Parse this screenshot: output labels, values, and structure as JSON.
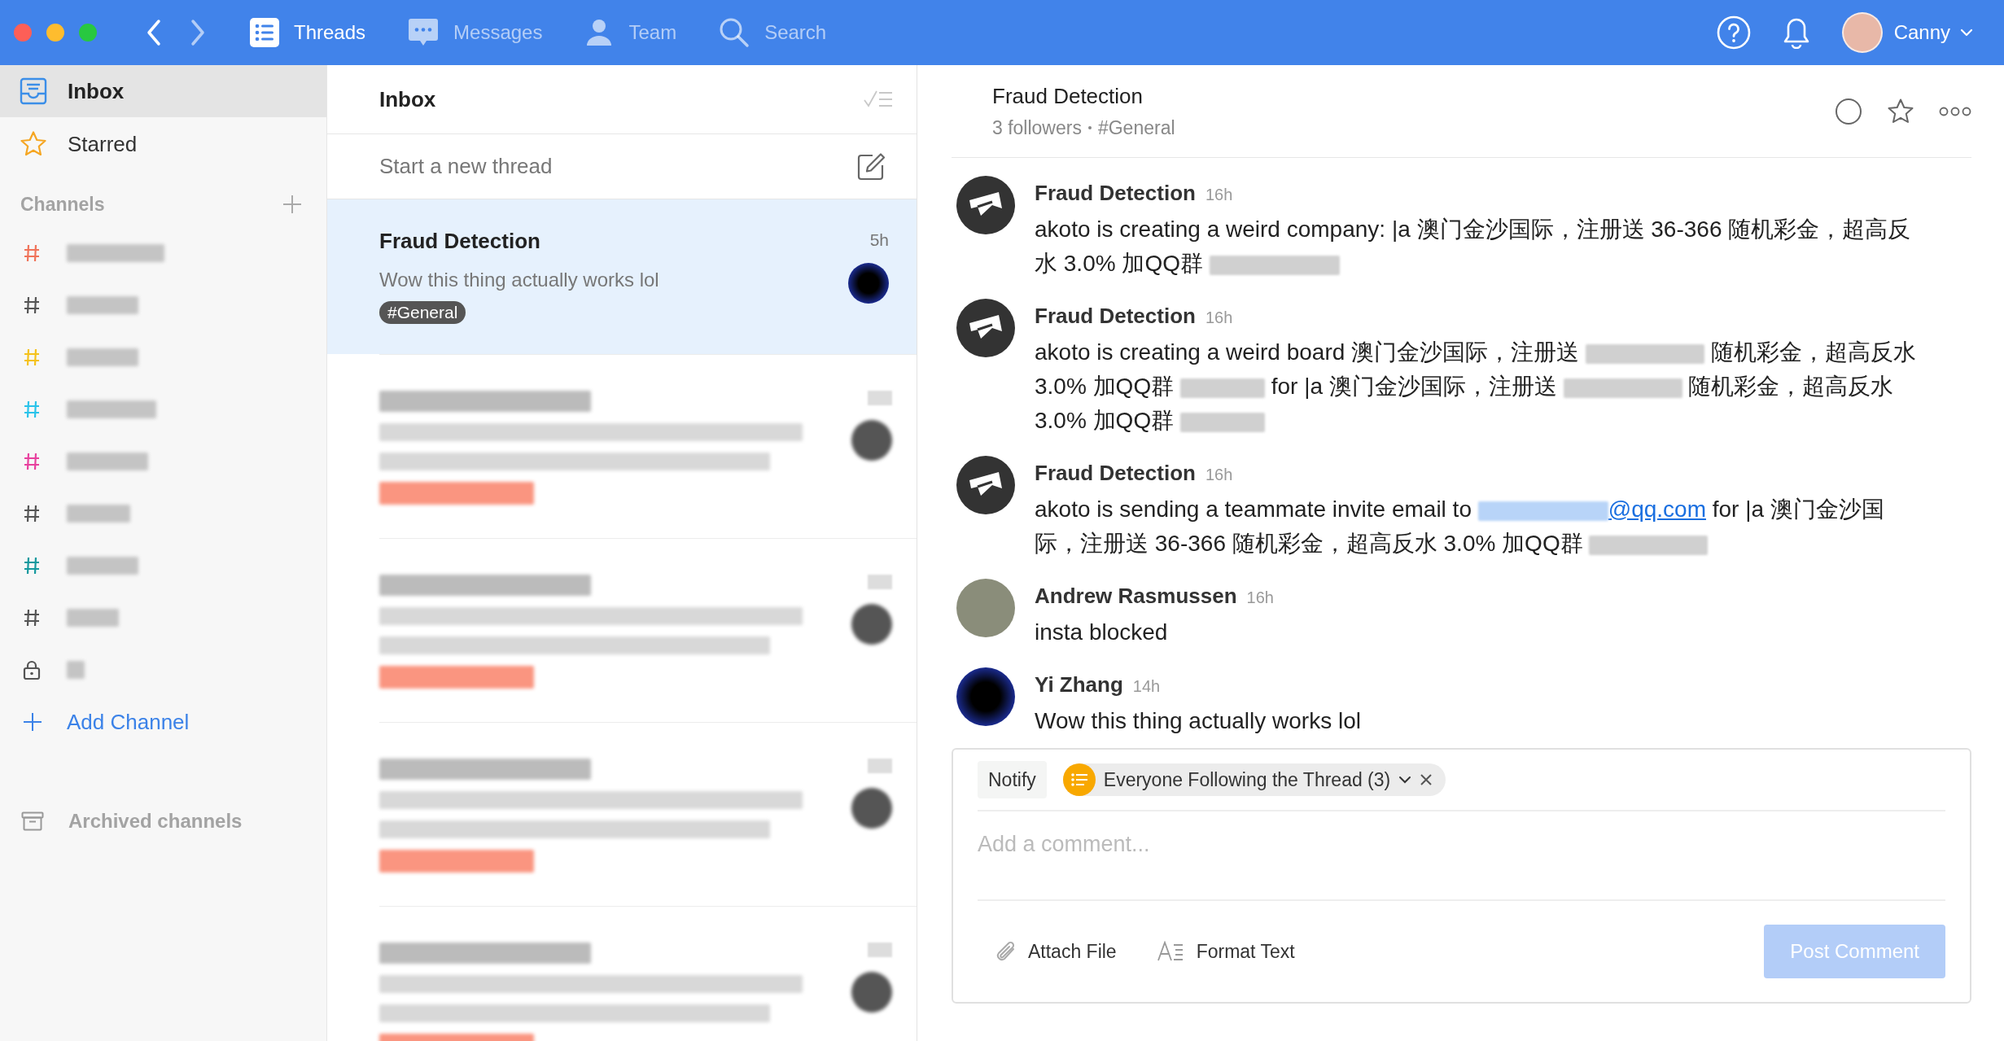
{
  "titlebar": {
    "nav": [
      {
        "kind": "threads",
        "label": "Threads",
        "selected": true
      },
      {
        "kind": "messages",
        "label": "Messages",
        "selected": false
      },
      {
        "kind": "team",
        "label": "Team",
        "selected": false
      },
      {
        "kind": "search",
        "label": "Search",
        "selected": false
      }
    ],
    "user": "Canny"
  },
  "sidebar": {
    "items": [
      {
        "kind": "inbox",
        "label": "Inbox",
        "selected": true
      },
      {
        "kind": "starred",
        "label": "Starred",
        "selected": false
      }
    ],
    "channels_heading": "Channels",
    "channels": [
      {
        "kind": "hash",
        "color": "#f0735a"
      },
      {
        "kind": "hash",
        "color": "#555555"
      },
      {
        "kind": "hash",
        "color": "#f5c21b"
      },
      {
        "kind": "hash",
        "color": "#29c3ea"
      },
      {
        "kind": "hash",
        "color": "#e8409e"
      },
      {
        "kind": "hash",
        "color": "#555555"
      },
      {
        "kind": "hash",
        "color": "#15999e"
      },
      {
        "kind": "hash",
        "color": "#555555"
      },
      {
        "kind": "lock",
        "color": "#555555"
      }
    ],
    "add_channel": "Add Channel",
    "archived": "Archived channels"
  },
  "thread_list": {
    "title": "Inbox",
    "new_thread_placeholder": "Start a new thread",
    "threads": [
      {
        "kind": "visible",
        "title": "Fraud Detection",
        "time": "5h",
        "preview": "Wow this thing actually works lol",
        "tag": "#General",
        "selected": true
      },
      {
        "kind": "blurred",
        "selected": false
      },
      {
        "kind": "blurred",
        "selected": false
      },
      {
        "kind": "blurred",
        "selected": false
      },
      {
        "kind": "blurred",
        "selected": false
      }
    ]
  },
  "thread": {
    "title": "Fraud Detection",
    "followers": "3 followers",
    "channel": "#General",
    "messages": [
      {
        "kind": "bot",
        "author": "Fraud Detection",
        "time": "16h",
        "body": [
          {
            "kind": "text",
            "text": "akoto is creating a weird company: |a 澳门金沙国际，注册送 36-366 随机彩金，超高反水 3.0% 加QQ群 "
          },
          {
            "kind": "blurred"
          }
        ]
      },
      {
        "kind": "bot",
        "author": "Fraud Detection",
        "time": "16h",
        "body": [
          {
            "kind": "text",
            "text": "akoto is creating a weird board 澳门金沙国际，注册送 "
          },
          {
            "kind": "blurred"
          },
          {
            "kind": "text",
            "text": " 随机彩金，超高反水 3.0% 加QQ群 "
          },
          {
            "kind": "blurred"
          },
          {
            "kind": "text",
            "text": " for |a 澳门金沙国际，注册送 "
          },
          {
            "kind": "blurred"
          },
          {
            "kind": "text",
            "text": " 随机彩金，超高反水 3.0% 加QQ群 "
          },
          {
            "kind": "blurred"
          }
        ]
      },
      {
        "kind": "bot",
        "author": "Fraud Detection",
        "time": "16h",
        "body": [
          {
            "kind": "text",
            "text": "akoto is sending a teammate invite email to "
          },
          {
            "kind": "blurred_link"
          },
          {
            "kind": "link",
            "text": "@qq.com"
          },
          {
            "kind": "text",
            "text": " for |a 澳门金沙国际，注册送 36-366 随机彩金，超高反水 3.0% 加QQ群 "
          },
          {
            "kind": "blurred"
          }
        ]
      },
      {
        "kind": "photo",
        "author": "Andrew Rasmussen",
        "time": "16h",
        "body": [
          {
            "kind": "text",
            "text": "insta blocked"
          }
        ]
      },
      {
        "kind": "fractal",
        "author": "Yi Zhang",
        "time": "14h",
        "body": [
          {
            "kind": "text",
            "text": "Wow this thing actually works lol"
          }
        ]
      }
    ]
  },
  "composer": {
    "notify_label": "Notify",
    "audience": "Everyone Following the Thread (3)",
    "placeholder": "Add a comment...",
    "attach": "Attach File",
    "format": "Format Text",
    "post": "Post Comment",
    "post_disabled": true
  }
}
